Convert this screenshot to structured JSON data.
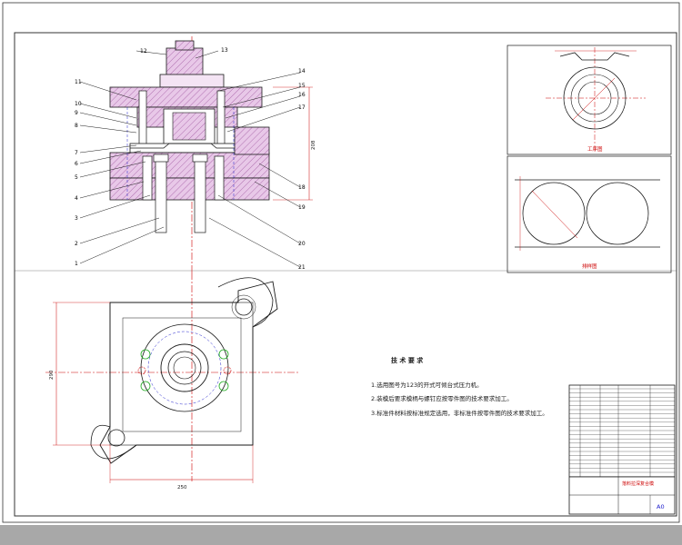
{
  "drawing": {
    "balloons": [
      "12",
      "13",
      "11",
      "10",
      "9",
      "8",
      "7",
      "6",
      "5",
      "4",
      "3",
      "2",
      "1",
      "14",
      "15",
      "16",
      "17",
      "18",
      "19",
      "20",
      "21"
    ],
    "dimensions": {
      "height": "208",
      "depth": "290",
      "width": "250"
    },
    "views": {
      "workpiece": "工序图",
      "layout": "排样图"
    },
    "tech_requirements": {
      "title": "技 术 要 求",
      "items": [
        "1.选用图号为123的开式可倾台式压力机。",
        "2.装模后要求模柄与螺钉应按零件图的技术要求加工。",
        "3.标准件材料按标准规定选用，非标准件按零件图的技术要求加工。"
      ]
    },
    "title_block": {
      "project": "落料拉深复合模",
      "sheet_size": "A0"
    }
  },
  "colors": {
    "line": "#1a1a1a",
    "center": "#cc0000",
    "section": "#c080c0",
    "hidden": "#2020cc",
    "circle": "#22aa22",
    "dim": "#cc0000"
  }
}
